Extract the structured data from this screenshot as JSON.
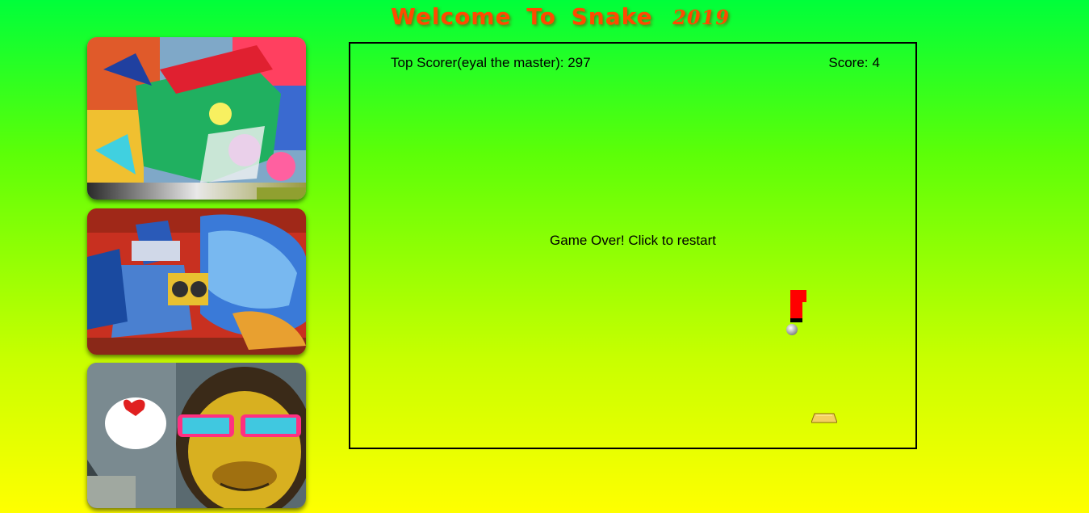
{
  "header": {
    "title": "Welcome To Snake",
    "year": "2019"
  },
  "gallery": [
    {
      "alt": "graffiti portrait mural"
    },
    {
      "alt": "graffiti character with boombox"
    },
    {
      "alt": "graffiti monkey with sunglasses"
    }
  ],
  "game": {
    "top_scorer_label": "Top Scorer(eyal the master): 297",
    "score_label": "Score:",
    "score_value": "4",
    "game_over_text": "Game Over! Click to restart",
    "colors": {
      "snake": "#ff0000",
      "border": "#000000",
      "title": "#ff4a00"
    }
  }
}
